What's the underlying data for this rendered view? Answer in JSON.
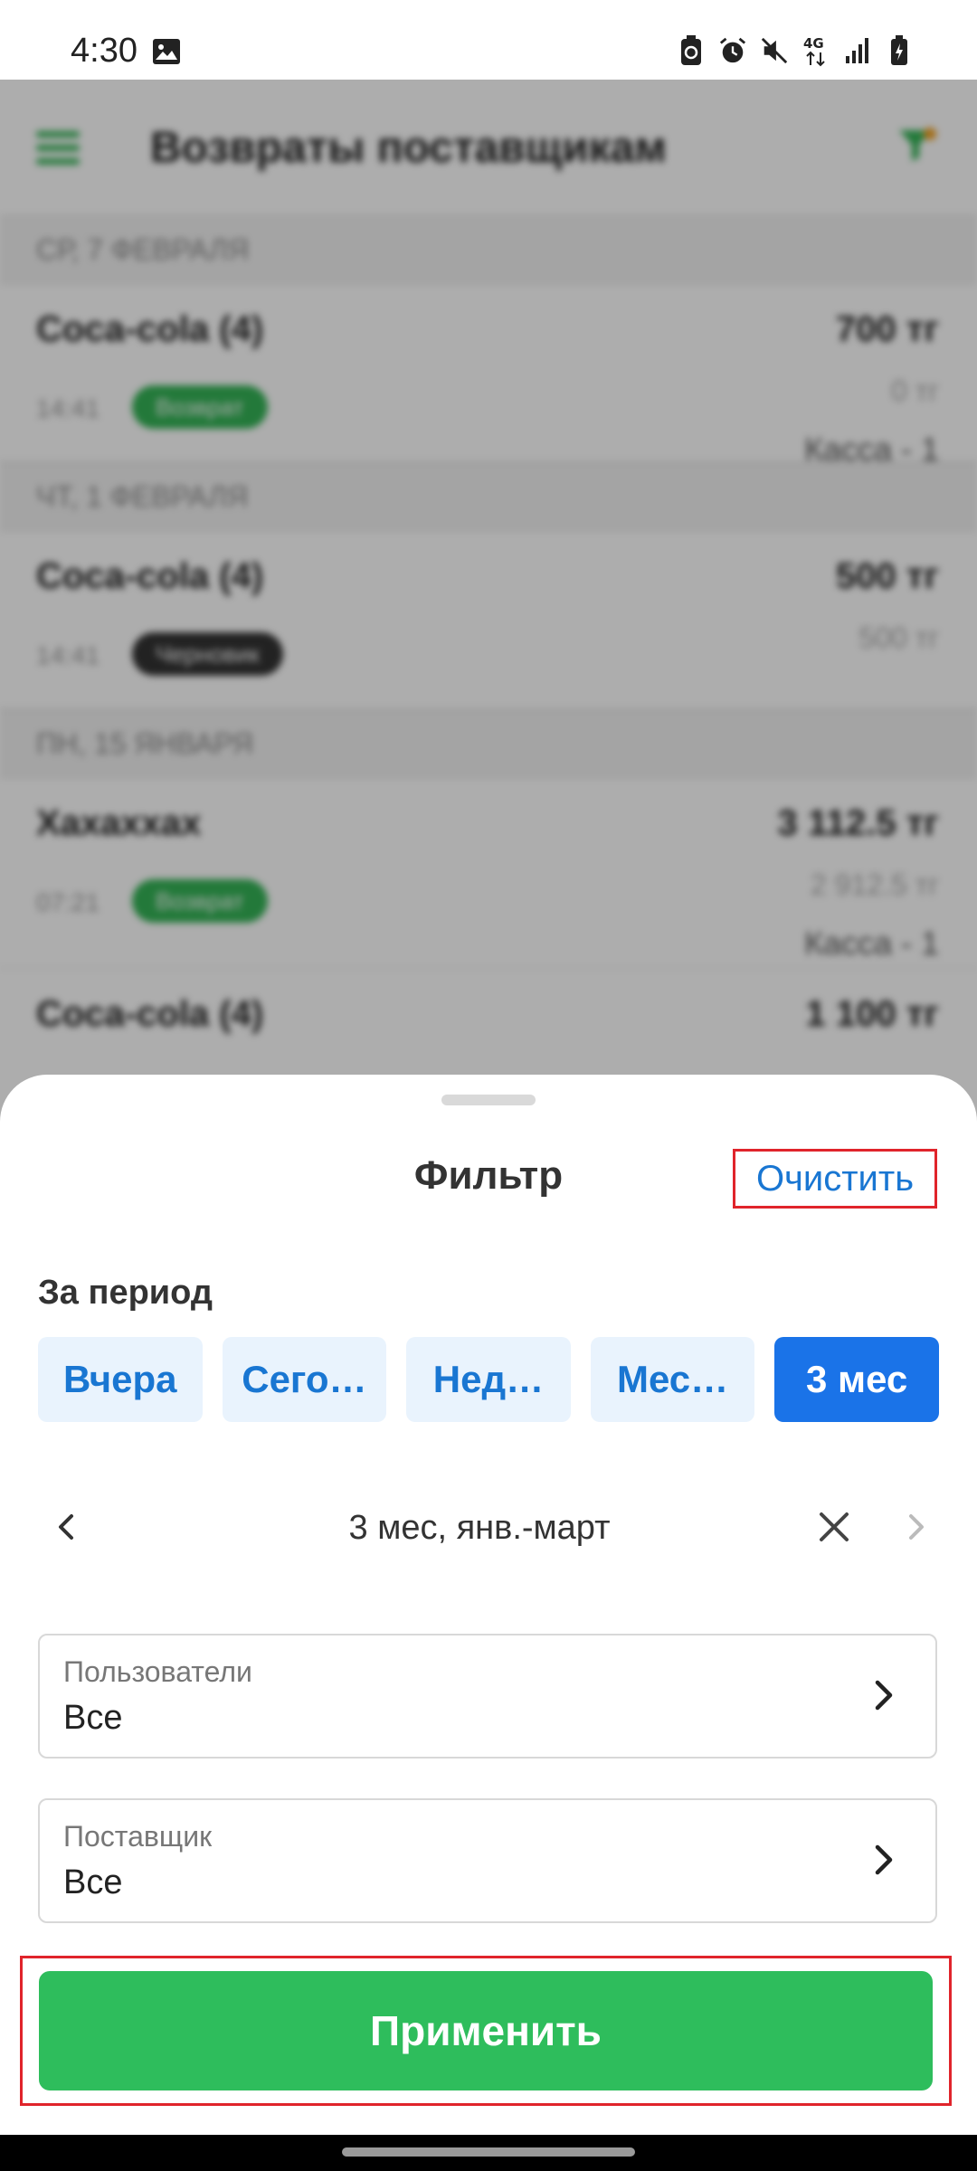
{
  "status_bar": {
    "time": "4:30",
    "icons": [
      "image-icon",
      "battery-saver-icon",
      "alarm-icon",
      "mute-icon",
      "4g-icon",
      "signal-icon",
      "battery-icon"
    ],
    "network": "4G"
  },
  "background": {
    "title": "Возвраты поставщикам",
    "sections": [
      {
        "header": "СР, 7 ФЕВРАЛЯ",
        "rows": [
          {
            "name": "Coca-cola (4)",
            "time": "14:41",
            "badge": "Возврат",
            "amount": "700 тг",
            "amount2": "0 тг",
            "cash": "Касса - 1"
          }
        ]
      },
      {
        "header": "ЧТ, 1 ФЕВРАЛЯ",
        "rows": [
          {
            "name": "Coca-cola (4)",
            "time": "14:41",
            "badge": "Черновик",
            "amount": "500 тг",
            "amount2": "500 тг",
            "cash": ""
          }
        ]
      },
      {
        "header": "ПН, 15 ЯНВАРЯ",
        "rows": [
          {
            "name": "Хахаххах",
            "time": "07:21",
            "badge": "Возврат",
            "amount": "3 112.5 тг",
            "amount2": "2 912.5 тг",
            "cash": "Касса - 1"
          },
          {
            "name": "Coca-cola (4)",
            "time": "",
            "badge": "",
            "amount": "1 100 тг",
            "amount2": "",
            "cash": ""
          }
        ]
      }
    ]
  },
  "sheet": {
    "title": "Фильтр",
    "clear_label": "Очистить",
    "period_label": "За период",
    "period_options": [
      {
        "label": "Вчера",
        "active": false
      },
      {
        "label": "Сего…",
        "active": false
      },
      {
        "label": "Нед…",
        "active": false
      },
      {
        "label": "Мес…",
        "active": false
      },
      {
        "label": "3 мес",
        "active": true
      }
    ],
    "range_text": "3 мес, янв.-март",
    "users_field": {
      "label": "Пользователи",
      "value": "Все"
    },
    "supplier_field": {
      "label": "Поставщик",
      "value": "Все"
    },
    "apply_label": "Применить"
  },
  "colors": {
    "accent_green": "#2ebd5c",
    "accent_blue": "#1a73e8",
    "highlight_red": "#e0242b"
  }
}
